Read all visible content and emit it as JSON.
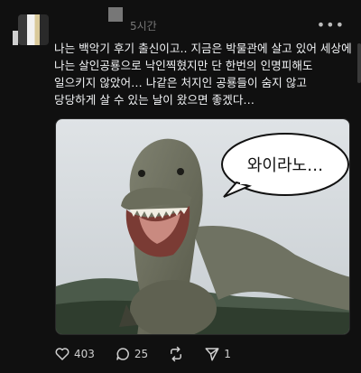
{
  "post": {
    "timestamp": "5시간",
    "more_label": "•••",
    "text": "나는 백악기 후기 출신이고.. 지금은 박물관에 살고 있어 세상에 나는 살인공룡으로 낙인찍혔지만 단 한번의 인명피해도 일으키지 않았어… 나같은 처지인 공룡들이 숨지 않고 당당하게 살 수 있는 날이 왔으면 좋겠다…",
    "image": {
      "speech_bubble": "와이라노…"
    }
  },
  "actions": {
    "likes": "403",
    "comments": "25",
    "shares": "1"
  }
}
